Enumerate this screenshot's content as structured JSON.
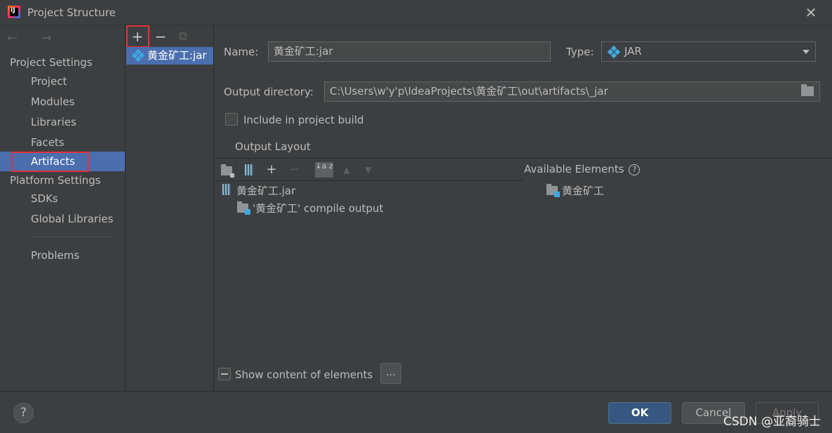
{
  "window": {
    "title": "Project Structure",
    "close_glyph": "✕"
  },
  "nav": {
    "back_forward": "← →",
    "project_settings_header": "Project Settings",
    "project_items": [
      "Project",
      "Modules",
      "Libraries",
      "Facets",
      "Artifacts"
    ],
    "platform_settings_header": "Platform Settings",
    "platform_items": [
      "SDKs",
      "Global Libraries"
    ],
    "problems": "Problems",
    "selected": "Artifacts"
  },
  "artifact_list": {
    "add_glyph": "+",
    "remove_glyph": "−",
    "copy_glyph": "⧉",
    "items": [
      "黄金矿工:jar"
    ]
  },
  "detail": {
    "name_label": "Name:",
    "name_value": "黄金矿工:jar",
    "type_label": "Type:",
    "type_value": "JAR",
    "output_dir_label": "Output directory:",
    "output_dir_value": "C:\\Users\\w'y'p\\IdeaProjects\\黄金矿工\\out\\artifacts\\_jar",
    "include_build_label": "Include in project build",
    "include_build_checked": false,
    "output_layout_tab": "Output Layout"
  },
  "layout_toolbar": {
    "add_glyph": "+",
    "remove_glyph": "−",
    "sort_glyph": "↓a z",
    "up_glyph": "▲",
    "down_glyph": "▼"
  },
  "output_tree": {
    "root": "黄金矿工.jar",
    "child": "'黄金矿工' compile output"
  },
  "available_elements": {
    "header": "Available Elements",
    "help_glyph": "?",
    "items": [
      "黄金矿工"
    ]
  },
  "show_content": {
    "label": "Show content of elements",
    "ellipsis": "..."
  },
  "footer": {
    "help_glyph": "?",
    "ok": "OK",
    "cancel": "Cancel",
    "apply": "Apply",
    "watermark": "CSDN @亚裔骑士"
  },
  "colors": {
    "background": "#3c3f41",
    "selection": "#4b6eaf",
    "highlight_box": "#e2323c",
    "primary_button": "#365880"
  }
}
